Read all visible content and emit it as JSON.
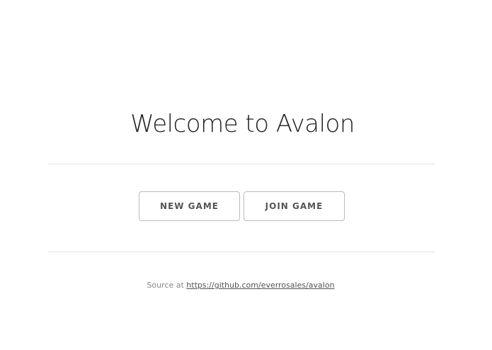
{
  "welcome": {
    "title": "Welcome to Avalon"
  },
  "actions": {
    "new_game_label": "NEW GAME",
    "join_game_label": "JOIN GAME"
  },
  "footer": {
    "source_prefix": "Source at",
    "source_link": "https://github.com/everrosales/avalon"
  }
}
